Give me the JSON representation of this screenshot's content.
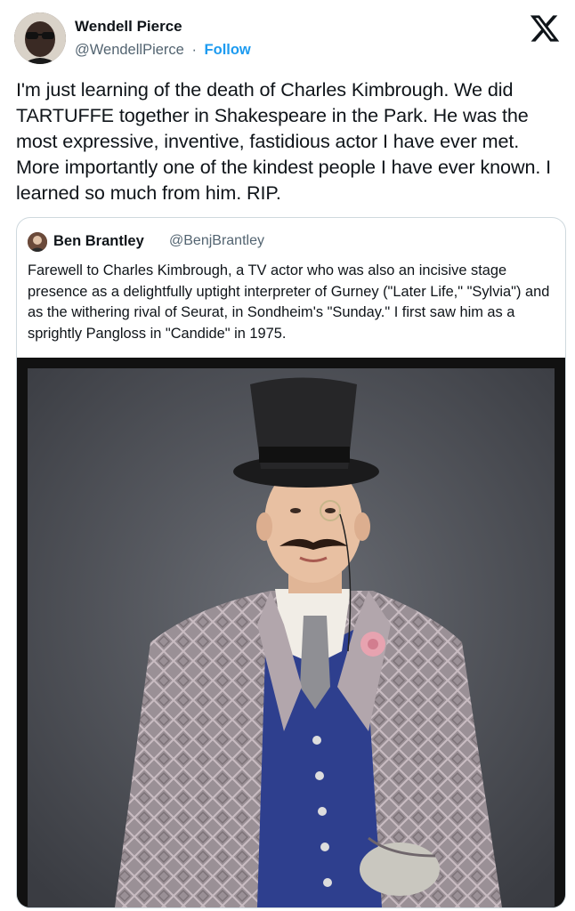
{
  "tweet": {
    "author_name": "Wendell Pierce",
    "author_handle": "@WendellPierce",
    "separator": "·",
    "follow_label": "Follow",
    "text": "I'm just learning of the death of Charles Kimbrough. We did TARTUFFE together in Shakespeare in the Park. He was the most expressive, inventive, fastidious actor I have ever met. More importantly one of the kindest people I have ever known. I learned so much from him. RIP.",
    "logo_icon": "x-logo-icon"
  },
  "quoted_tweet": {
    "author_name": "Ben Brantley",
    "author_handle": "@BenjBrantley",
    "text": "Farewell to Charles Kimbrough, a TV actor who was also an incisive stage presence as a delightfully uptight interpreter of Gurney (\"Later Life,\" \"Sylvia\") and as the withering rival of Seurat, in Sondheim's \"Sunday.\" I first saw him as a sprightly Pangloss in \"Candide\" in 1975."
  },
  "colors": {
    "text": "#0f1419",
    "secondary": "#536471",
    "accent": "#1d9bf0",
    "border": "#cfd9de"
  }
}
